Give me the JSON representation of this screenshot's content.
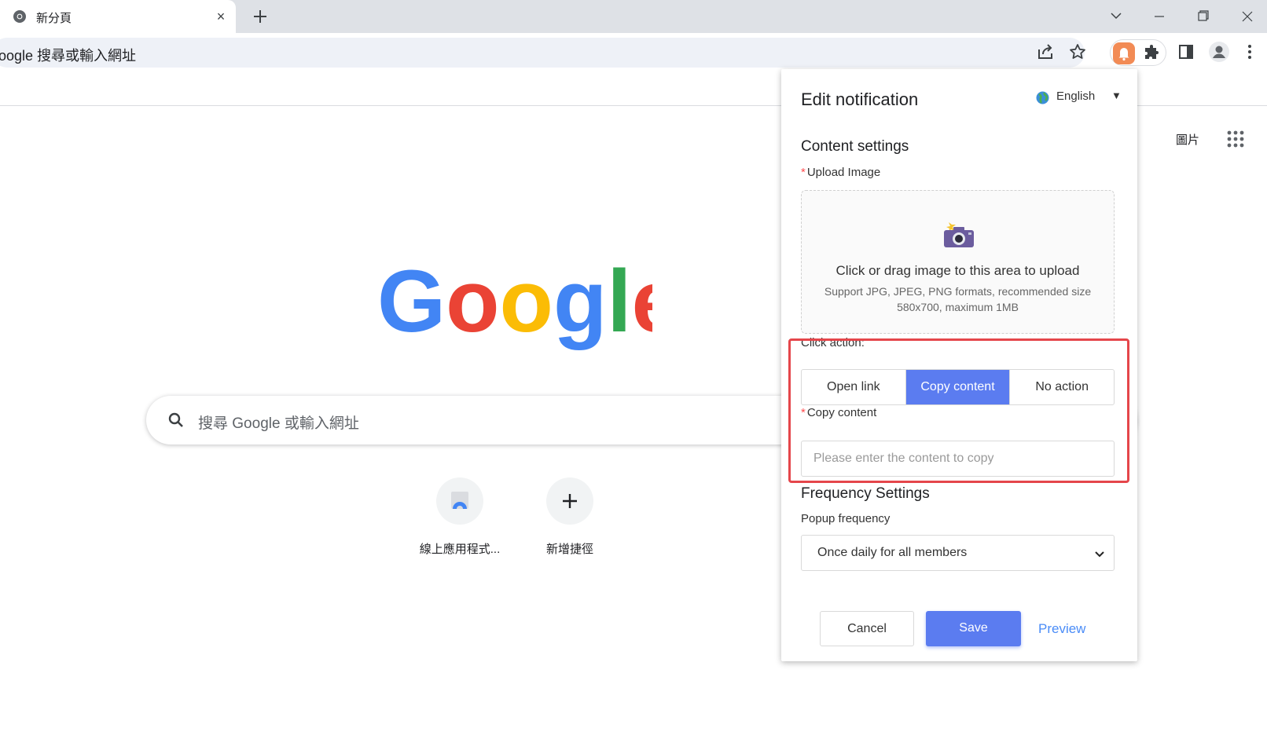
{
  "tab": {
    "title": "新分頁",
    "close": "×"
  },
  "omnibox": {
    "text": "oogle 搜尋或輸入網址"
  },
  "ntp": {
    "images_link": "圖片",
    "search_placeholder": "搜尋 Google 或輸入網址",
    "shortcuts": [
      {
        "label": "線上應用程式..."
      },
      {
        "label": "新增捷徑"
      }
    ]
  },
  "popup": {
    "title": "Edit notification",
    "language": "English",
    "language_caret": "▼",
    "content_settings": "Content settings",
    "required_mark": "*",
    "upload_label": "Upload Image",
    "upload_text": "Click or drag image to this area to upload",
    "upload_hint": "Support JPG, JPEG, PNG formats, recommended size 580x700, maximum 1MB",
    "click_action_label": "Click action:",
    "click_actions": [
      "Open link",
      "Copy content",
      "No action"
    ],
    "selected_action": "Copy content",
    "copy_content_label": "Copy content",
    "copy_content_placeholder": "Please enter the content to copy",
    "frequency_title": "Frequency Settings",
    "popup_frequency_label": "Popup frequency",
    "popup_frequency_value": "Once daily for all members",
    "cancel": "Cancel",
    "save": "Save",
    "preview": "Preview"
  },
  "colors": {
    "accent": "#5b7cf0",
    "highlight": "#e5464b",
    "required": "#ff4d4f",
    "link": "#4a8cf7"
  }
}
